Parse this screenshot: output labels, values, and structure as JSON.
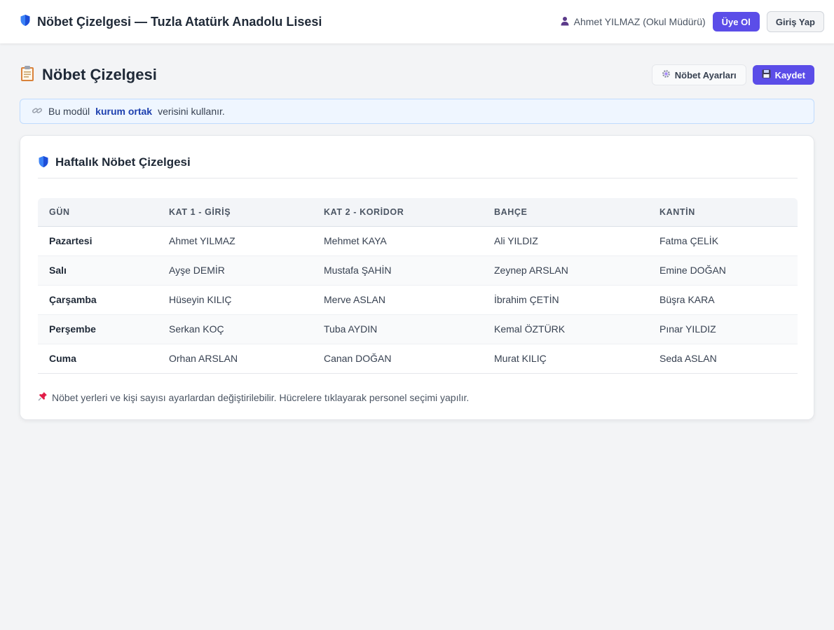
{
  "header": {
    "title": "Nöbet Çizelgesi — Tuzla Atatürk Anadolu Lisesi",
    "user": "Ahmet YILMAZ (Okul Müdürü)",
    "signup_label": "Üye Ol",
    "login_label": "Giriş Yap"
  },
  "page": {
    "title": "Nöbet Çizelgesi",
    "settings_label": "Nöbet Ayarları",
    "save_label": "Kaydet"
  },
  "info": {
    "prefix": "Bu modül",
    "highlight": "kurum ortak",
    "suffix": "verisini kullanır."
  },
  "card": {
    "title": "Haftalık Nöbet Çizelgesi",
    "note": "Nöbet yerleri ve kişi sayısı ayarlardan değiştirilebilir. Hücrelere tıklayarak personel seçimi yapılır."
  },
  "table": {
    "columns": [
      "GÜN",
      "KAT 1 - GİRİŞ",
      "KAT 2 - KORİDOR",
      "BAHÇE",
      "KANTİN"
    ],
    "rows": [
      [
        "Pazartesi",
        "Ahmet YILMAZ",
        "Mehmet KAYA",
        "Ali YILDIZ",
        "Fatma ÇELİK"
      ],
      [
        "Salı",
        "Ayşe DEMİR",
        "Mustafa ŞAHİN",
        "Zeynep ARSLAN",
        "Emine DOĞAN"
      ],
      [
        "Çarşamba",
        "Hüseyin KILIÇ",
        "Merve ASLAN",
        "İbrahim ÇETİN",
        "Büşra KARA"
      ],
      [
        "Perşembe",
        "Serkan KOÇ",
        "Tuba AYDIN",
        "Kemal ÖZTÜRK",
        "Pınar YILDIZ"
      ],
      [
        "Cuma",
        "Orhan ARSLAN",
        "Canan DOĞAN",
        "Murat KILIÇ",
        "Seda ASLAN"
      ]
    ]
  },
  "colors": {
    "accent": "#5b4de8",
    "info_bg": "#eff6ff",
    "info_strong": "#1e40af"
  },
  "icons": {
    "brand": "shield-icon",
    "user": "user-icon",
    "page": "clipboard-icon",
    "settings": "gear-icon",
    "save": "floppy-disk-icon",
    "info": "link-icon",
    "card": "shield-icon",
    "note": "pushpin-icon"
  }
}
